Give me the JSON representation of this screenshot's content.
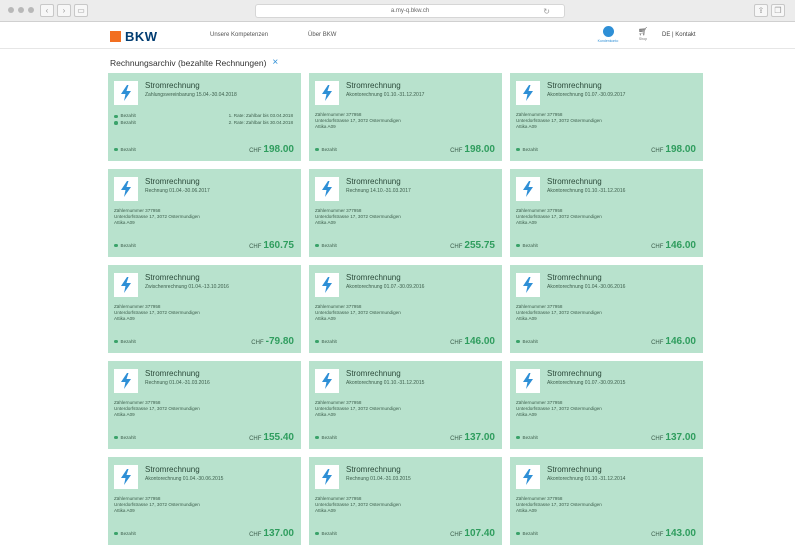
{
  "browser": {
    "url": "a.my-q.bkw.ch"
  },
  "header": {
    "logo_text": "BKW",
    "nav": [
      "Unsere Kompetenzen",
      "Über BKW"
    ],
    "account_label": "Kundenkonto",
    "cart_label": "Shop",
    "lang_contact": "DE | Kontakt"
  },
  "page": {
    "title": "Rechnungsarchiv (bezahlte Rechnungen)",
    "close_symbol": "×"
  },
  "colors": {
    "card_bg": "#b8e2cd",
    "amount": "#2f9d5e",
    "brand_orange": "#f26f21",
    "brand_blue": "#003c71",
    "accent_blue": "#2e8fd6"
  },
  "invoices": [
    {
      "title": "Stromrechnung",
      "subtitle": "Zahlungsvereinbarung 15.04.-30.04.2018",
      "rates": [
        {
          "status": "Bezahlt",
          "text": "1. Rate: Zahlbar bis 03.04.2018"
        },
        {
          "status": "Bezahlt",
          "text": "2. Rate: Zahlbar bis 30.04.2018"
        }
      ],
      "status": "Bezahlt",
      "currency": "CHF",
      "amount": "198.00"
    },
    {
      "title": "Stromrechnung",
      "subtitle": "Akontorechnung 01.10.-31.12.2017",
      "meter": "Zählernummer 377958",
      "address": "Unterdorfstrasse 17, 3072 Ostermundigen",
      "unit": "Attika A09",
      "status": "Bezahlt",
      "currency": "CHF",
      "amount": "198.00"
    },
    {
      "title": "Stromrechnung",
      "subtitle": "Akontorechnung 01.07.-30.09.2017",
      "meter": "Zählernummer 377958",
      "address": "Unterdorfstrasse 17, 3072 Ostermundigen",
      "unit": "Attika A09",
      "status": "Bezahlt",
      "currency": "CHF",
      "amount": "198.00"
    },
    {
      "title": "Stromrechnung",
      "subtitle": "Rechnung 01.04.-30.06.2017",
      "meter": "Zählernummer 377958",
      "address": "Unterdorfstrasse 17, 3072 Ostermundigen",
      "unit": "Attika A09",
      "status": "Bezahlt",
      "currency": "CHF",
      "amount": "160.75"
    },
    {
      "title": "Stromrechnung",
      "subtitle": "Rechnung 14.10.-31.03.2017",
      "meter": "Zählernummer 377958",
      "address": "Unterdorfstrasse 17, 3072 Ostermundigen",
      "unit": "Attika A09",
      "status": "Bezahlt",
      "currency": "CHF",
      "amount": "255.75"
    },
    {
      "title": "Stromrechnung",
      "subtitle": "Akontorechnung 01.10.-31.12.2016",
      "meter": "Zählernummer 377958",
      "address": "Unterdorfstrasse 17, 3072 Ostermundigen",
      "unit": "Attika A09",
      "status": "Bezahlt",
      "currency": "CHF",
      "amount": "146.00"
    },
    {
      "title": "Stromrechnung",
      "subtitle": "Zwischenrechnung 01.04.-13.10.2016",
      "meter": "Zählernummer 377958",
      "address": "Unterdorfstrasse 17, 3072 Ostermundigen",
      "unit": "Attika A09",
      "status": "Bezahlt",
      "currency": "CHF",
      "amount": "-79.80"
    },
    {
      "title": "Stromrechnung",
      "subtitle": "Akontorechnung 01.07.-30.09.2016",
      "meter": "Zählernummer 377958",
      "address": "Unterdorfstrasse 17, 3072 Ostermundigen",
      "unit": "Attika A09",
      "status": "Bezahlt",
      "currency": "CHF",
      "amount": "146.00"
    },
    {
      "title": "Stromrechnung",
      "subtitle": "Akontorechnung 01.04.-30.06.2016",
      "meter": "Zählernummer 377958",
      "address": "Unterdorfstrasse 17, 3072 Ostermundigen",
      "unit": "Attika A09",
      "status": "Bezahlt",
      "currency": "CHF",
      "amount": "146.00"
    },
    {
      "title": "Stromrechnung",
      "subtitle": "Rechnung 01.04.-31.03.2016",
      "meter": "Zählernummer 377958",
      "address": "Unterdorfstrasse 17, 3072 Ostermundigen",
      "unit": "Attika A09",
      "status": "Bezahlt",
      "currency": "CHF",
      "amount": "155.40"
    },
    {
      "title": "Stromrechnung",
      "subtitle": "Akontorechnung 01.10.-31.12.2015",
      "meter": "Zählernummer 377958",
      "address": "Unterdorfstrasse 17, 3072 Ostermundigen",
      "unit": "Attika A09",
      "status": "Bezahlt",
      "currency": "CHF",
      "amount": "137.00"
    },
    {
      "title": "Stromrechnung",
      "subtitle": "Akontorechnung 01.07.-30.09.2015",
      "meter": "Zählernummer 377958",
      "address": "Unterdorfstrasse 17, 3072 Ostermundigen",
      "unit": "Attika A09",
      "status": "Bezahlt",
      "currency": "CHF",
      "amount": "137.00"
    },
    {
      "title": "Stromrechnung",
      "subtitle": "Akontorechnung 01.04.-30.06.2015",
      "meter": "Zählernummer 377958",
      "address": "Unterdorfstrasse 17, 3072 Ostermundigen",
      "unit": "Attika A09",
      "status": "Bezahlt",
      "currency": "CHF",
      "amount": "137.00"
    },
    {
      "title": "Stromrechnung",
      "subtitle": "Rechnung 01.04.-31.03.2015",
      "meter": "Zählernummer 377958",
      "address": "Unterdorfstrasse 17, 3072 Ostermundigen",
      "unit": "Attika A09",
      "status": "Bezahlt",
      "currency": "CHF",
      "amount": "107.40"
    },
    {
      "title": "Stromrechnung",
      "subtitle": "Akontorechnung 01.10.-31.12.2014",
      "meter": "Zählernummer 377958",
      "address": "Unterdorfstrasse 17, 3072 Ostermundigen",
      "unit": "Attika A09",
      "status": "Bezahlt",
      "currency": "CHF",
      "amount": "143.00"
    }
  ]
}
